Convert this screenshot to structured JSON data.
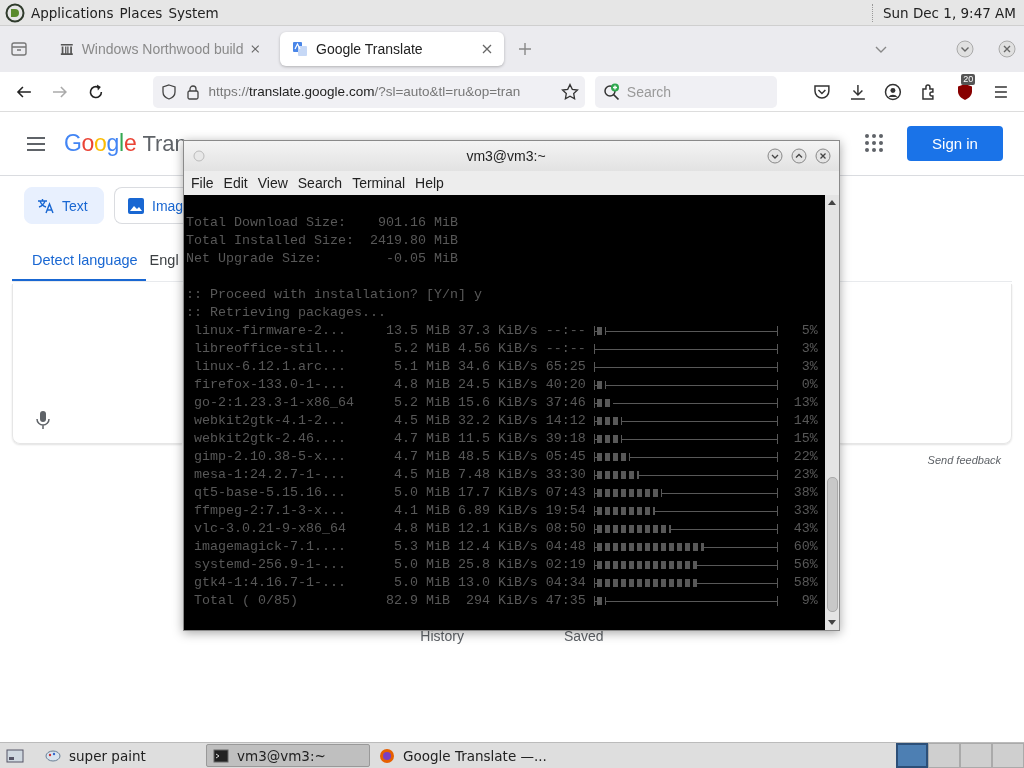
{
  "panel": {
    "menus": [
      "Applications",
      "Places",
      "System"
    ],
    "clock": "Sun Dec 1, 9:47 AM"
  },
  "browser": {
    "tabs": [
      {
        "title": "Windows Northwood build",
        "selected": false
      },
      {
        "title": "Google Translate",
        "selected": true
      }
    ],
    "url": {
      "scheme": "https://",
      "domain": "translate.google.com",
      "path": "/?sl=auto&tl=ru&op=tran"
    },
    "search": {
      "placeholder": "Search"
    },
    "addon_badge": "20"
  },
  "page": {
    "logo": "Google",
    "product": "Tran",
    "sign_in": "Sign in",
    "modes": [
      {
        "label": "Text",
        "selected": true
      },
      {
        "label": "Imag",
        "selected": false
      }
    ],
    "languages": [
      {
        "label": "Detect language",
        "selected": true
      },
      {
        "label": "Engl",
        "selected": false
      }
    ],
    "feedback": "Send feedback",
    "footer": [
      "History",
      "Saved"
    ]
  },
  "terminal": {
    "title": "vm3@vm3:~",
    "menu": [
      "File",
      "Edit",
      "View",
      "Search",
      "Terminal",
      "Help"
    ],
    "summary": [
      "Total Download Size:    901.16 MiB",
      "Total Installed Size:  2419.80 MiB",
      "Net Upgrade Size:        -0.05 MiB"
    ],
    "prompt": [
      ":: Proceed with installation? [Y/n] y",
      ":: Retrieving packages..."
    ],
    "downloads": [
      {
        "name": "linux-firmware-2...",
        "size": "13.5 MiB",
        "speed": "37.3 KiB/s",
        "eta": "--:--",
        "level": 0.05,
        "percent": "5%"
      },
      {
        "name": "libreoffice-stil...",
        "size": "5.2 MiB",
        "speed": "4.56 KiB/s",
        "eta": "--:--",
        "level": 0,
        "percent": "3%"
      },
      {
        "name": "linux-6.12.1.arc...",
        "size": "5.1 MiB",
        "speed": "34.6 KiB/s",
        "eta": "65:25",
        "level": 0,
        "percent": "3%"
      },
      {
        "name": "firefox-133.0-1-...",
        "size": "4.8 MiB",
        "speed": "24.5 KiB/s",
        "eta": "40:20",
        "level": 0.05,
        "percent": "0%"
      },
      {
        "name": "go-2:1.23.3-1-x86_64",
        "size": "5.2 MiB",
        "speed": "15.6 KiB/s",
        "eta": "37:46",
        "level": 0.09,
        "percent": "13%"
      },
      {
        "name": "webkit2gtk-4.1-2...",
        "size": "4.5 MiB",
        "speed": "32.2 KiB/s",
        "eta": "14:12",
        "level": 0.14,
        "percent": "14%"
      },
      {
        "name": "webkit2gtk-2.46....",
        "size": "4.7 MiB",
        "speed": "11.5 KiB/s",
        "eta": "39:18",
        "level": 0.14,
        "percent": "15%"
      },
      {
        "name": "gimp-2.10.38-5-x...",
        "size": "4.7 MiB",
        "speed": "48.5 KiB/s",
        "eta": "05:45",
        "level": 0.18,
        "percent": "22%"
      },
      {
        "name": "mesa-1:24.2.7-1-...",
        "size": "4.5 MiB",
        "speed": "7.48 KiB/s",
        "eta": "33:30",
        "level": 0.23,
        "percent": "23%"
      },
      {
        "name": "qt5-base-5.15.16...",
        "size": "5.0 MiB",
        "speed": "17.7 KiB/s",
        "eta": "07:43",
        "level": 0.36,
        "percent": "38%"
      },
      {
        "name": "ffmpeg-2:7.1-3-x...",
        "size": "4.1 MiB",
        "speed": "6.89 KiB/s",
        "eta": "19:54",
        "level": 0.32,
        "percent": "33%"
      },
      {
        "name": "vlc-3.0.21-9-x86_64",
        "size": "4.8 MiB",
        "speed": "12.1 KiB/s",
        "eta": "08:50",
        "level": 0.41,
        "percent": "43%"
      },
      {
        "name": "imagemagick-7.1....",
        "size": "5.3 MiB",
        "speed": "12.4 KiB/s",
        "eta": "04:48",
        "level": 0.59,
        "percent": "60%"
      },
      {
        "name": "systemd-256.9-1-...",
        "size": "5.0 MiB",
        "speed": "25.8 KiB/s",
        "eta": "02:19",
        "level": 0.55,
        "percent": "56%"
      },
      {
        "name": "gtk4-1:4.16.7-1-...",
        "size": "5.0 MiB",
        "speed": "13.0 KiB/s",
        "eta": "04:34",
        "level": 0.55,
        "percent": "58%"
      },
      {
        "name": "Total ( 0/85)",
        "size": "82.9 MiB",
        "speed": "294 KiB/s",
        "eta": "47:35",
        "level": 0.05,
        "percent": "9%"
      }
    ]
  },
  "taskbar": {
    "items": [
      {
        "label": "super paint",
        "kind": "paint",
        "selected": false
      },
      {
        "label": "vm3@vm3:~",
        "kind": "terminal",
        "selected": true
      },
      {
        "label": "Google Translate —...",
        "kind": "browser",
        "selected": false
      }
    ],
    "workspaces": [
      {
        "selected": true
      },
      {
        "selected": false
      },
      {
        "selected": false
      },
      {
        "selected": false
      }
    ]
  }
}
